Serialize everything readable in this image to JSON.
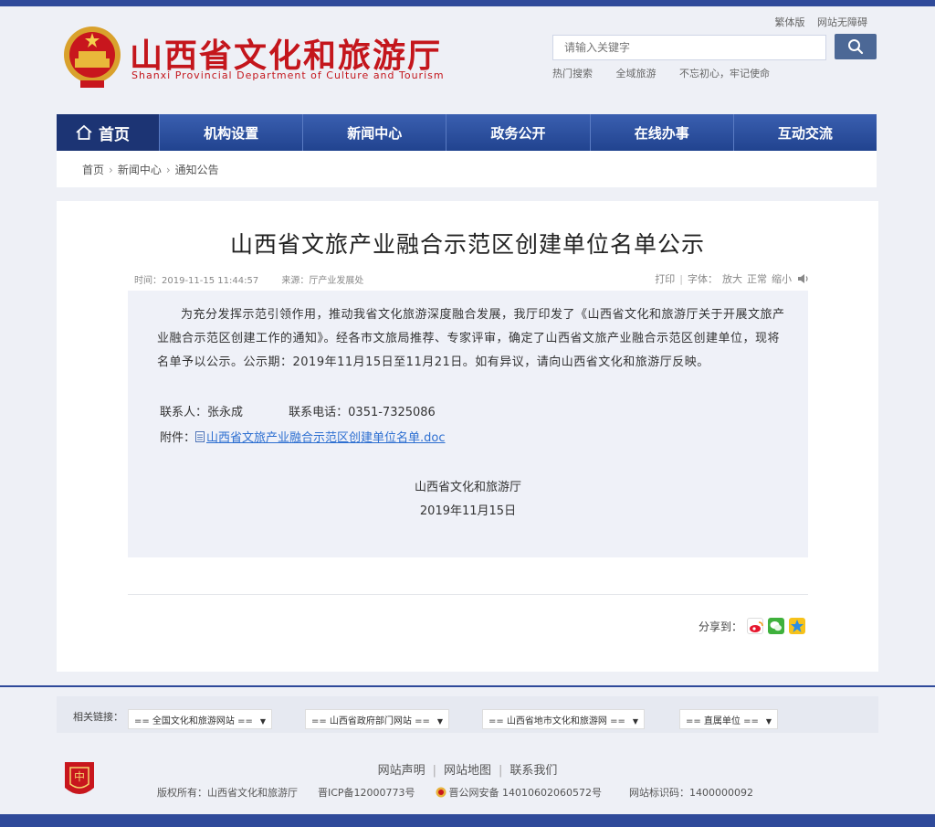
{
  "header": {
    "title": "山西省文化和旅游厅",
    "subtitle": "Shanxi Provincial Department of Culture and Tourism",
    "top_links": [
      "繁体版",
      "网站无障碍"
    ],
    "search_placeholder": "请输入关键字",
    "hot_words": [
      "热门搜索",
      "全域旅游",
      "不忘初心，牢记使命"
    ]
  },
  "nav": {
    "items": [
      "首页",
      "机构设置",
      "新闻中心",
      "政务公开",
      "在线办事",
      "互动交流"
    ]
  },
  "breadcrumb": [
    "首页",
    "新闻中心",
    "通知公告"
  ],
  "article": {
    "title": "山西省文旅产业融合示范区创建单位名单公示",
    "time": "时间：2019-11-15 11:44:57",
    "source": "来源：厅产业发展处",
    "tools": {
      "print": "打印",
      "font_label": "字体：",
      "sizes": [
        "放大",
        "正常",
        "缩小"
      ]
    },
    "paragraph": "为充分发挥示范引领作用，推动我省文化旅游深度融合发展，我厅印发了《山西省文化和旅游厅关于开展文旅产业融合示范区创建工作的通知》。经各市文旅局推荐、专家评审，确定了山西省文旅产业融合示范区创建单位，现将名单予以公示。公示期：2019年11月15日至11月21日。如有异议，请向山西省文化和旅游厅反映。",
    "contact_label": "联系人：张永成",
    "phone_label": "联系电话：0351-7325086",
    "attachment_label": "附件：",
    "attachment_link": "山西省文旅产业融合示范区创建单位名单.doc",
    "sign_org": "山西省文化和旅游厅",
    "sign_date": "2019年11月15日",
    "share_label": "分享到："
  },
  "footer": {
    "links_label": "相关链接：",
    "link_selects": [
      "== 全国文化和旅游网站 ==",
      "== 山西省政府部门网站 ==",
      "== 山西省地市文化和旅游网 ==",
      "== 直属单位 =="
    ],
    "nav": [
      "网站声明",
      "网站地图",
      "联系我们"
    ],
    "copyright": "版权所有：山西省文化和旅游厅",
    "icp": "晋ICP备12000773号",
    "police": "晋公网安备 14010602060572号",
    "site_id": "网站标识码：1400000092"
  },
  "colors": {
    "brand_red": "#c4161c",
    "nav_blue": "#2f4a9a",
    "link_blue": "#2d6fd1"
  }
}
